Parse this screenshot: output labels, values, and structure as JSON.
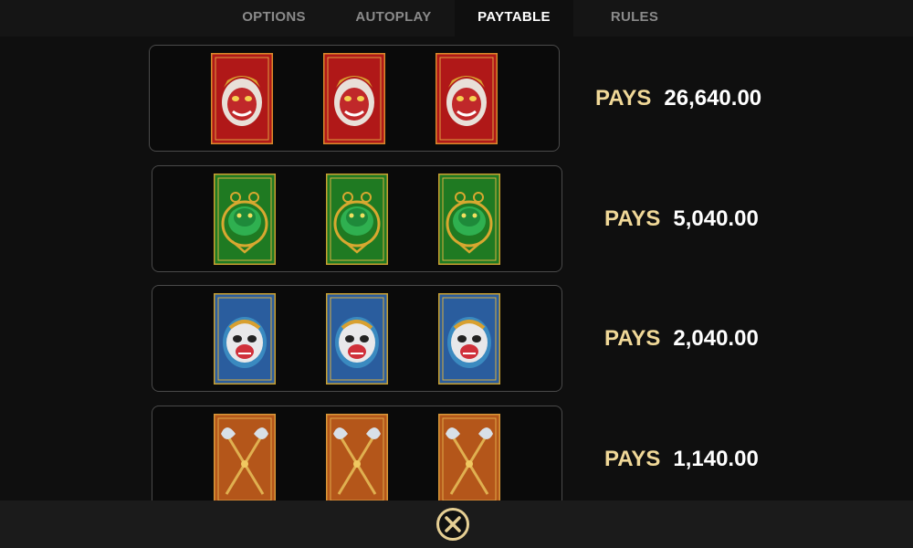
{
  "tabs": [
    {
      "label": "OPTIONS",
      "active": false
    },
    {
      "label": "AUTOPLAY",
      "active": false
    },
    {
      "label": "PAYTABLE",
      "active": true
    },
    {
      "label": "RULES",
      "active": false
    }
  ],
  "paytable": {
    "rows": [
      {
        "symbol": "red-demon-mask-icon",
        "count": 3,
        "pays_label": "PAYS",
        "amount": "26,640.00"
      },
      {
        "symbol": "green-jade-dragon-icon",
        "count": 3,
        "pays_label": "PAYS",
        "amount": "5,040.00"
      },
      {
        "symbol": "blue-monkey-mask-icon",
        "count": 3,
        "pays_label": "PAYS",
        "amount": "2,040.00"
      },
      {
        "symbol": "crossed-axes-icon",
        "count": 3,
        "pays_label": "PAYS",
        "amount": "1,140.00"
      }
    ]
  },
  "footer": {
    "close_icon": "close-icon"
  },
  "colors": {
    "accent_gold": "#e6cf94",
    "pays_label": "#f0d898",
    "card_red": "#b01818",
    "card_green": "#1f7a22",
    "card_blue": "#2a5d9e",
    "card_orange": "#b4561a"
  }
}
